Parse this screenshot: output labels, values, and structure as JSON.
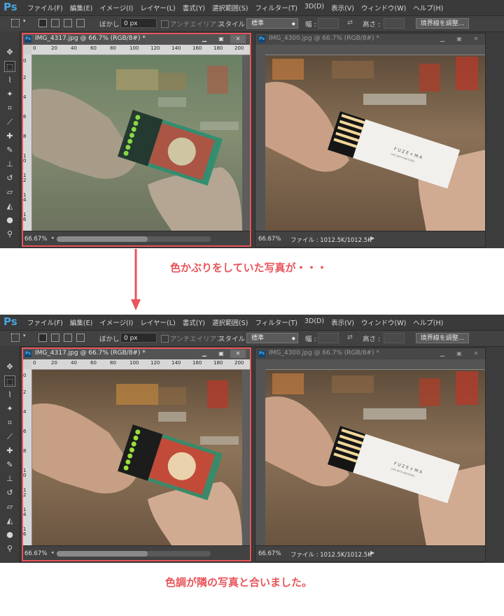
{
  "menubar": {
    "logo": "Ps",
    "items": [
      "ファイル(F)",
      "編集(E)",
      "イメージ(I)",
      "レイヤー(L)",
      "書式(Y)",
      "選択範囲(S)",
      "フィルター(T)",
      "3D(D)",
      "表示(V)",
      "ウィンドウ(W)",
      "ヘルプ(H)"
    ]
  },
  "options": {
    "feather_label": "ぼかし :",
    "feather_value": "0 px",
    "antialias_label": "アンチエイリアス",
    "style_label": "スタイル :",
    "style_value": "標準",
    "width_label": "幅 :",
    "height_label": "高さ :",
    "refine_button": "境界線を調整..."
  },
  "doc_left": {
    "title": "IMG_4317.jpg @ 66.7% (RGB/8#) *",
    "zoom": "66.67%"
  },
  "doc_right": {
    "title": "IMG_4300.jpg @ 66.7% (RGB/8#) *",
    "zoom": "66.67%",
    "file_info": "ファイル : 1012.5K/1012.5K"
  },
  "ruler": {
    "h_ticks": [
      "0",
      "20",
      "40",
      "60",
      "80",
      "100",
      "120",
      "140",
      "160",
      "180",
      "200"
    ],
    "v_ticks": [
      "0",
      "2",
      "4",
      "6",
      "8",
      "10",
      "12",
      "14",
      "16"
    ]
  },
  "photo": {
    "box_text_line1": "FUZE+MA",
    "box_text_line2": "LIFE WITH MATCHES"
  },
  "captions": {
    "first": "色かぶりをしていた写真が・・・",
    "second": "色調が隣の写真と合いました。"
  },
  "colors": {
    "accent": "#e8555b",
    "ps_blue": "#4aa3df",
    "panel_bg": "#3c3c3c"
  }
}
